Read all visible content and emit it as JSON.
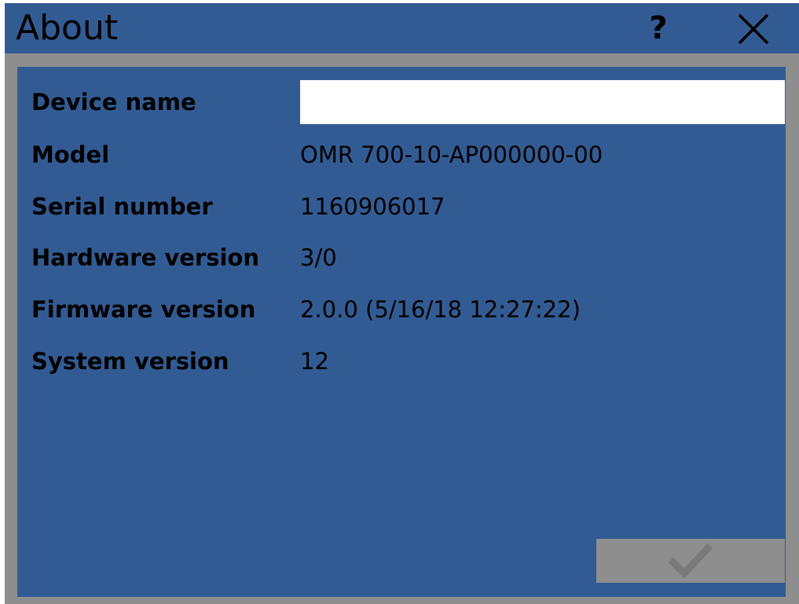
{
  "window": {
    "title": "About",
    "help_icon": "question-mark-icon",
    "close_icon": "close-x-icon"
  },
  "fields": {
    "device_name": {
      "label": "Device name",
      "value": "",
      "placeholder": ""
    },
    "model": {
      "label": "Model",
      "value": "OMR 700-10-AP000000-00"
    },
    "serial_number": {
      "label": "Serial number",
      "value": "1160906017"
    },
    "hardware_version": {
      "label": "Hardware version",
      "value": "3/0"
    },
    "firmware_version": {
      "label": "Firmware version",
      "value": "2.0.0 (5/16/18 12:27:22)"
    },
    "system_version": {
      "label": "System version",
      "value": "12"
    }
  },
  "actions": {
    "ok_icon": "checkmark-icon",
    "ok_enabled": false
  },
  "colors": {
    "titlebar": "#335b93",
    "content": "#335b93",
    "frame": "#8e8e8e",
    "input_bg": "#ffffff",
    "button_disabled": "#8e8e8e",
    "checkmark_disabled": "#7a7a7a"
  }
}
